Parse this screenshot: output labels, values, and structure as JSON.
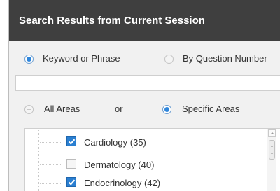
{
  "header": {
    "title": "Search Results from Current Session"
  },
  "search_mode": {
    "options": [
      {
        "label": "Keyword or Phrase",
        "selected": true
      },
      {
        "label": "By Question Number",
        "selected": false
      }
    ]
  },
  "search_input": {
    "value": "",
    "placeholder": ""
  },
  "area_scope": {
    "all_label": "All Areas",
    "or_label": "or",
    "specific_label": "Specific Areas",
    "selected": "Specific Areas"
  },
  "areas": [
    {
      "label": "Cardiology (35)",
      "checked": true
    },
    {
      "label": "Dermatology (40)",
      "checked": false
    },
    {
      "label": "Endocrinology (42)",
      "checked": true
    }
  ],
  "colors": {
    "header_bg": "#3f3f3f",
    "panel_bg": "#f1f1f1",
    "accent_blue": "#2a7fd1"
  }
}
